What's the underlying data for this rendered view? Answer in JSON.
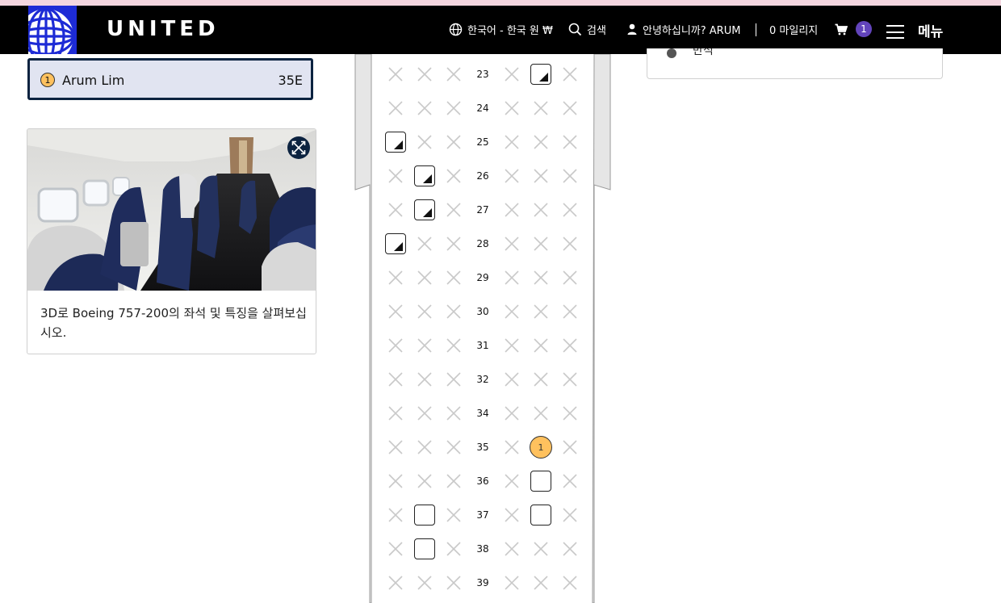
{
  "header": {
    "brand": "UNITED",
    "language": "한국어 - 한국 원 ₩",
    "search": "검색",
    "greeting": "안녕하십니까? ARUM",
    "miles": "0 마일리지",
    "cart_count": "1",
    "menu": "메뉴"
  },
  "traveler": {
    "number": "1",
    "name": "Arum Lim",
    "seat": "35E"
  },
  "cabin_view": {
    "description": "3D로 Boeing 757-200의 좌석 및 특징을 살펴보십시오."
  },
  "legend": {
    "partial_text": "만석"
  },
  "seat_map": {
    "rows": [
      {
        "num": "23",
        "seats": [
          "x",
          "x",
          "x",
          "x",
          "premium",
          "x"
        ]
      },
      {
        "num": "24",
        "seats": [
          "x",
          "x",
          "x",
          "x",
          "x",
          "x"
        ]
      },
      {
        "num": "25",
        "seats": [
          "premium",
          "x",
          "x",
          "x",
          "x",
          "x"
        ]
      },
      {
        "num": "26",
        "seats": [
          "x",
          "premium",
          "x",
          "x",
          "x",
          "x"
        ]
      },
      {
        "num": "27",
        "seats": [
          "x",
          "premium",
          "x",
          "x",
          "x",
          "x"
        ]
      },
      {
        "num": "28",
        "seats": [
          "premium",
          "x",
          "x",
          "x",
          "x",
          "x"
        ]
      },
      {
        "num": "29",
        "seats": [
          "x",
          "x",
          "x",
          "x",
          "x",
          "x"
        ]
      },
      {
        "num": "30",
        "seats": [
          "x",
          "x",
          "x",
          "x",
          "x",
          "x"
        ]
      },
      {
        "num": "31",
        "seats": [
          "x",
          "x",
          "x",
          "x",
          "x",
          "x"
        ]
      },
      {
        "num": "32",
        "seats": [
          "x",
          "x",
          "x",
          "x",
          "x",
          "x"
        ]
      },
      {
        "num": "34",
        "seats": [
          "x",
          "x",
          "x",
          "x",
          "x",
          "x"
        ]
      },
      {
        "num": "35",
        "seats": [
          "x",
          "x",
          "x",
          "x",
          "selected",
          "x"
        ]
      },
      {
        "num": "36",
        "seats": [
          "x",
          "x",
          "x",
          "x",
          "open",
          "x"
        ]
      },
      {
        "num": "37",
        "seats": [
          "x",
          "open",
          "x",
          "x",
          "open",
          "x"
        ]
      },
      {
        "num": "38",
        "seats": [
          "x",
          "open",
          "x",
          "x",
          "x",
          "x"
        ]
      },
      {
        "num": "39",
        "seats": [
          "x",
          "x",
          "x",
          "x",
          "x",
          "x"
        ]
      }
    ],
    "selected_label": "1"
  },
  "colors": {
    "header_bg": "#000000",
    "brand_blue": "#1d2bd6",
    "navy": "#0c2340",
    "traveler_card_bg": "#e1e4f1",
    "selected_seat": "#ffc15e",
    "cart_badge": "#6244bb"
  }
}
